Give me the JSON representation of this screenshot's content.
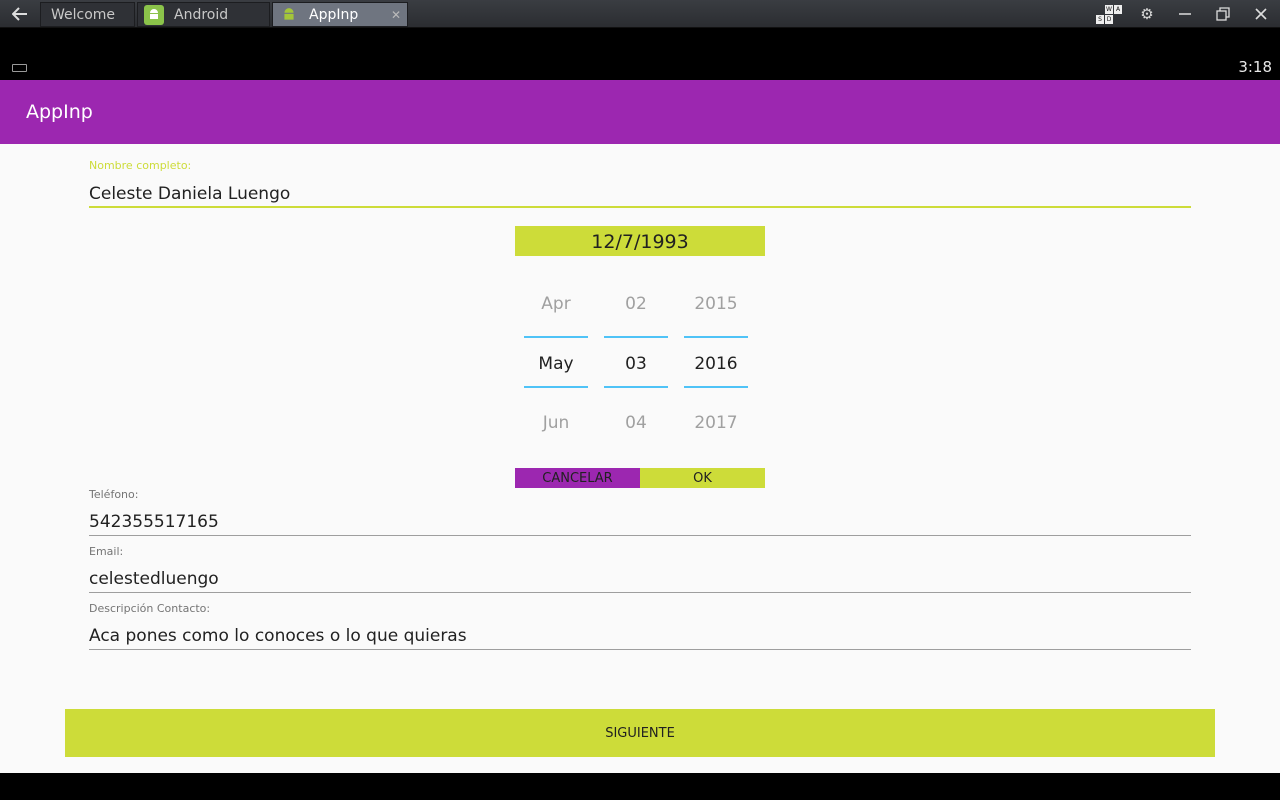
{
  "emulator": {
    "tabs": [
      {
        "label": "Welcome"
      },
      {
        "label": "Android",
        "icon": "android-icon"
      },
      {
        "label": "AppInp",
        "icon": "android-icon"
      }
    ],
    "keyboard_keys": [
      "W",
      "A",
      "S",
      "D"
    ]
  },
  "status_bar": {
    "time": "3:18"
  },
  "app": {
    "title": "AppInp",
    "accent": "#cddc39",
    "primary": "#9c27b0"
  },
  "form": {
    "nombre": {
      "label": "Nombre completo:",
      "value": "Celeste Daniela Luengo"
    },
    "telefono": {
      "label": "Teléfono:",
      "value": "542355517165"
    },
    "email": {
      "label": "Email:",
      "value": "celestedluengo"
    },
    "descripcion": {
      "label": "Descripción Contacto:",
      "value": "Aca pones como lo conoces o lo que quieras"
    }
  },
  "date_picker": {
    "display": "12/7/1993",
    "month": {
      "prev": "Apr",
      "selected": "May",
      "next": "Jun"
    },
    "day": {
      "prev": "02",
      "selected": "03",
      "next": "04"
    },
    "year": {
      "prev": "2015",
      "selected": "2016",
      "next": "2017"
    },
    "cancel_label": "CANCELAR",
    "ok_label": "OK"
  },
  "next_button": {
    "label": "SIGUIENTE"
  }
}
